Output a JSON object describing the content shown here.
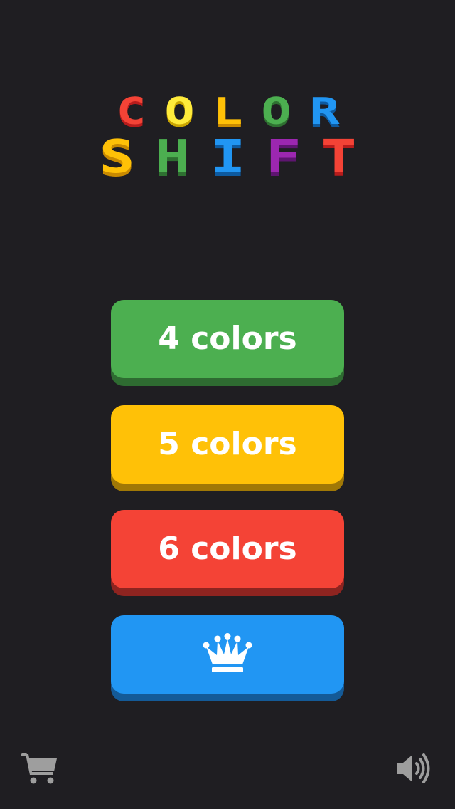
{
  "logo": {
    "line1": [
      {
        "char": "C",
        "color": "#f44336",
        "shade": "#b71c1c"
      },
      {
        "char": "O",
        "color": "#ffeb3b",
        "shade": "#c9a400"
      },
      {
        "char": "L",
        "color": "#ffc107",
        "shade": "#c98a00"
      },
      {
        "char": "O",
        "color": "#4caf50",
        "shade": "#2e7031"
      },
      {
        "char": "R",
        "color": "#2196f3",
        "shade": "#0d5aa0"
      }
    ],
    "line2": [
      {
        "char": "S",
        "color": "#ffc107",
        "shade": "#c98a00"
      },
      {
        "char": "H",
        "color": "#4caf50",
        "shade": "#2e7031"
      },
      {
        "char": "I",
        "color": "#2196f3",
        "shade": "#0d5aa0"
      },
      {
        "char": "F",
        "color": "#9c27b0",
        "shade": "#5e1570"
      },
      {
        "char": "T",
        "color": "#f44336",
        "shade": "#b71c1c"
      }
    ]
  },
  "menu": {
    "buttons": [
      {
        "label": "4 colors",
        "color": "#4caf50",
        "shade": "#2e6b31"
      },
      {
        "label": "5 colors",
        "color": "#ffc107",
        "shade": "#a07806"
      },
      {
        "label": "6 colors",
        "color": "#f44336",
        "shade": "#8e2420"
      },
      {
        "icon": "crown-icon",
        "color": "#2196f3",
        "shade": "#145a97"
      }
    ]
  },
  "footer": {
    "left_icon": "shopping-cart-icon",
    "right_icon": "speaker-volume-icon",
    "icon_color": "#9e9e9e"
  },
  "theme": {
    "background": "#1f1e22"
  }
}
